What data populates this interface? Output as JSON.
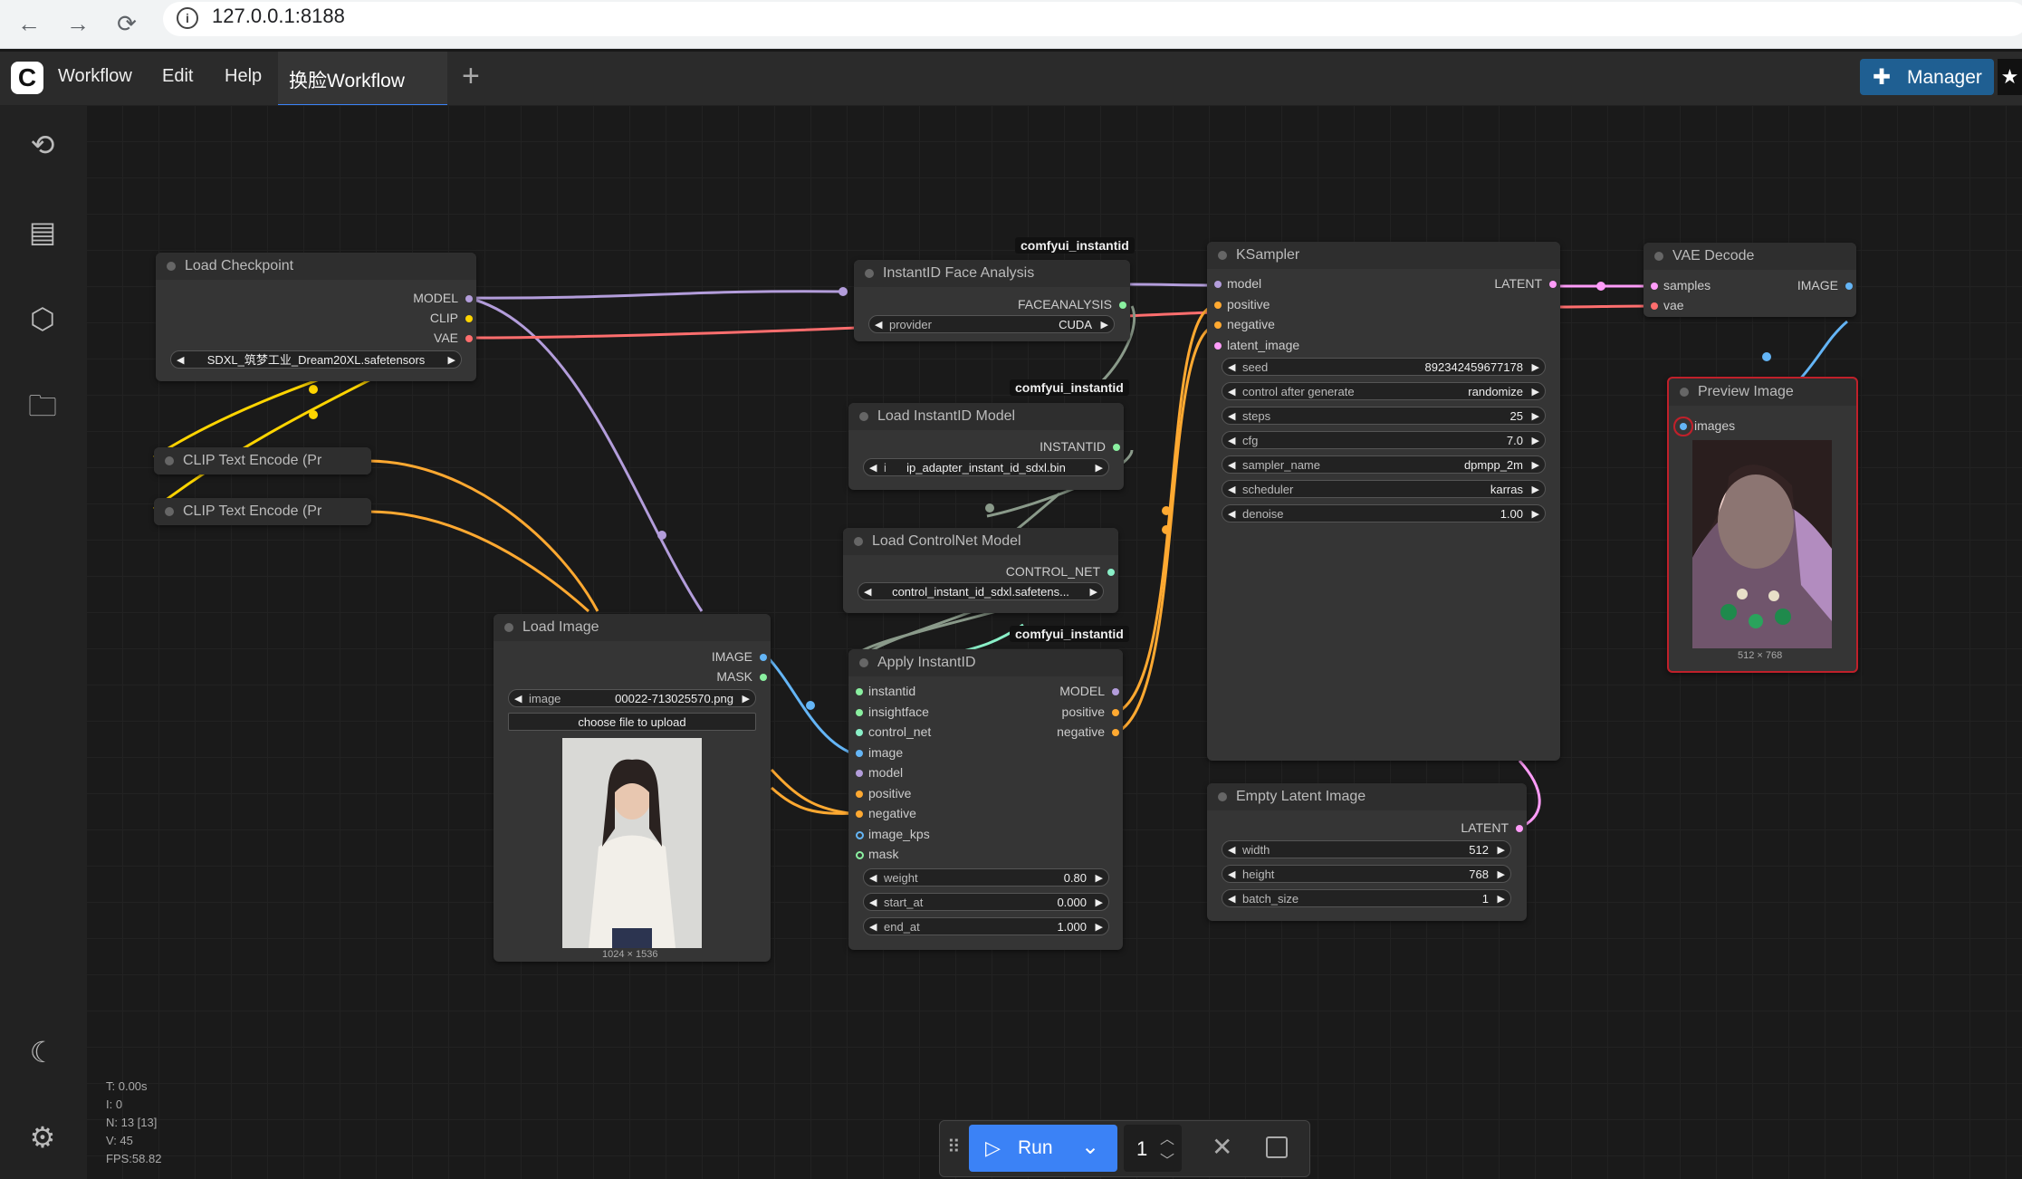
{
  "browser": {
    "url": "127.0.0.1:8188",
    "back": "←",
    "forward": "→",
    "reload": "⟳",
    "info": "i"
  },
  "app": {
    "logo": "C",
    "menu": [
      "Workflow",
      "Edit",
      "Help"
    ],
    "active_tab": "换脸Workflow",
    "new_tab": "+",
    "manager_label": "Manager",
    "star": "★"
  },
  "sidebar": {
    "icons": [
      "history-icon",
      "queue-icon",
      "model-library-icon",
      "workflows-icon",
      "theme-icon",
      "settings-icon"
    ],
    "glyphs": [
      "⟲",
      "▤",
      "⬡",
      "🗀",
      "☾",
      "⚙"
    ]
  },
  "nodes": {
    "load_checkpoint": {
      "title": "Load Checkpoint",
      "outputs": [
        "MODEL",
        "CLIP",
        "VAE"
      ],
      "ckpt_name": "SDXL_筑梦工业_Dream20XL.safetensors"
    },
    "clip_text_1": {
      "title": "CLIP Text Encode (Pr"
    },
    "clip_text_2": {
      "title": "CLIP Text Encode (Pr"
    },
    "face_analysis": {
      "badge": "comfyui_instantid",
      "title": "InstantID Face Analysis",
      "output": "FACEANALYSIS",
      "provider_label": "provider",
      "provider_value": "CUDA"
    },
    "load_instantid": {
      "badge": "comfyui_instantid",
      "title": "Load InstantID Model",
      "output": "INSTANTID",
      "model_label": "i",
      "model_value": "ip_adapter_instant_id_sdxl.bin"
    },
    "load_controlnet": {
      "title": "Load ControlNet Model",
      "output": "CONTROL_NET",
      "model_value": "control_instant_id_sdxl.safetens..."
    },
    "load_image": {
      "title": "Load Image",
      "outputs": [
        "IMAGE",
        "MASK"
      ],
      "image_label": "image",
      "image_value": "00022-713025570.png",
      "upload_label": "choose file to upload",
      "size": "1024 × 1536"
    },
    "apply_instantid": {
      "badge": "comfyui_instantid",
      "title": "Apply InstantID",
      "inputs": [
        "instantid",
        "insightface",
        "control_net",
        "image",
        "model",
        "positive",
        "negative",
        "image_kps",
        "mask"
      ],
      "outputs": [
        "MODEL",
        "positive",
        "negative"
      ],
      "weight_label": "weight",
      "weight_value": "0.80",
      "start_label": "start_at",
      "start_value": "0.000",
      "end_label": "end_at",
      "end_value": "1.000"
    },
    "ksampler": {
      "title": "KSampler",
      "inputs": [
        "model",
        "positive",
        "negative",
        "latent_image"
      ],
      "output": "LATENT",
      "widgets": [
        {
          "label": "seed",
          "value": "892342459677178"
        },
        {
          "label": "control after generate",
          "value": "randomize"
        },
        {
          "label": "steps",
          "value": "25"
        },
        {
          "label": "cfg",
          "value": "7.0"
        },
        {
          "label": "sampler_name",
          "value": "dpmpp_2m"
        },
        {
          "label": "scheduler",
          "value": "karras"
        },
        {
          "label": "denoise",
          "value": "1.00"
        }
      ]
    },
    "empty_latent": {
      "title": "Empty Latent Image",
      "output": "LATENT",
      "widgets": [
        {
          "label": "width",
          "value": "512"
        },
        {
          "label": "height",
          "value": "768"
        },
        {
          "label": "batch_size",
          "value": "1"
        }
      ]
    },
    "vae_decode": {
      "title": "VAE Decode",
      "inputs": [
        "samples",
        "vae"
      ],
      "output": "IMAGE"
    },
    "preview_image": {
      "title": "Preview Image",
      "input": "images",
      "size": "512 × 768"
    }
  },
  "stats": [
    "T: 0.00s",
    "I: 0",
    "N: 13 [13]",
    "V: 45",
    "FPS:58.82"
  ],
  "runbar": {
    "grip": "⠿",
    "run_label": "Run",
    "run_icon": "▷",
    "dropdown": "⌄",
    "count": "1",
    "cancel": "✕"
  },
  "colors": {
    "model": "#b39ddb",
    "clip": "#ffd500",
    "vae": "#ff6e6e",
    "image": "#64b5f6",
    "latent": "#ff9cf9",
    "conditioning": "#ffa931",
    "accent": "#3b82f6"
  }
}
